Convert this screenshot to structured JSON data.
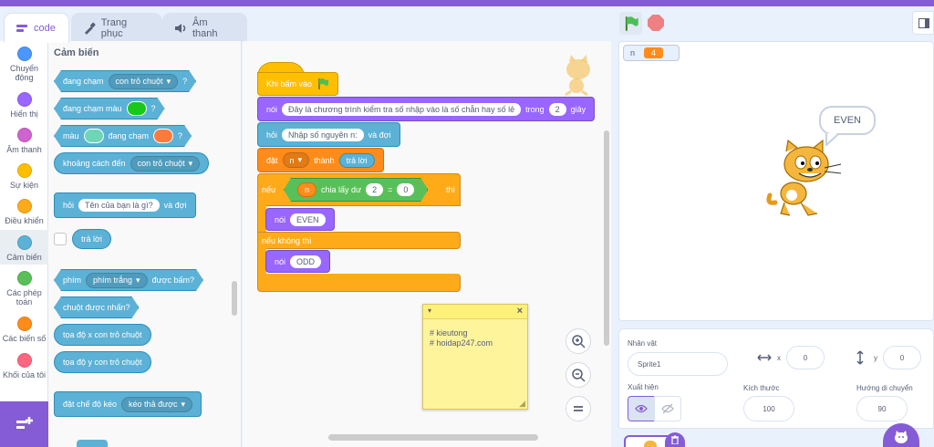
{
  "tabs": [
    {
      "label": "code"
    },
    {
      "label": "Trang phục"
    },
    {
      "label": "Âm thanh"
    }
  ],
  "categories": [
    {
      "label": "Chuyển động",
      "color": "#4c97ff"
    },
    {
      "label": "Hiển thị",
      "color": "#9966ff"
    },
    {
      "label": "Âm thanh",
      "color": "#cf63cf"
    },
    {
      "label": "Sự kiện",
      "color": "#ffbf00"
    },
    {
      "label": "Điều khiển",
      "color": "#ffab19"
    },
    {
      "label": "Cảm biến",
      "color": "#5cb1d6"
    },
    {
      "label": "Các phép toán",
      "color": "#59c059"
    },
    {
      "label": "Các biến số",
      "color": "#ff8c1a"
    },
    {
      "label": "Khối của tôi",
      "color": "#ff6680"
    }
  ],
  "palette": {
    "title": "Cảm biến",
    "touching": {
      "label": "đang chạm",
      "value": "con trỏ chuột",
      "end": "?"
    },
    "touching_color": {
      "label": "đang chạm màu",
      "end": "?"
    },
    "color_touching": {
      "label1": "màu",
      "label2": "đang chạm",
      "end": "?"
    },
    "distance": {
      "label": "khoảng cách đến",
      "value": "con trỏ chuột"
    },
    "ask": {
      "label": "hỏi",
      "value": "Tên của bạn là gì?",
      "end": "và đợi"
    },
    "answer": {
      "label": "trả lời"
    },
    "key": {
      "label": "phím",
      "value": "phím trắng",
      "end": "được bấm?"
    },
    "mouse_down": {
      "label": "chuột được nhấn?"
    },
    "mouse_x": {
      "label": "tọa độ x con trỏ chuột"
    },
    "mouse_y": {
      "label": "tọa độ y con trỏ chuột"
    },
    "drag": {
      "label": "đặt chế độ kéo",
      "value": "kéo thả được"
    }
  },
  "script": {
    "hat": "Khi bấm vào",
    "say_label": "nói",
    "say_text": "Đây là chương trình kiểm tra số nhập vào là số chẵn hay số lẻ",
    "say_in": "trong",
    "say_secs": "2",
    "say_unit": "giây",
    "ask_label": "hỏi",
    "ask_text": "Nhập số nguyên n:",
    "ask_end": "và đợi",
    "set_label": "đặt",
    "set_var": "n",
    "set_to": "thành",
    "set_value": "trả lời",
    "if_label": "nếu",
    "if_var": "n",
    "mod_label": "chia lấy dư",
    "mod_value": "2",
    "eq": "=",
    "eq_value": "0",
    "then_label": "thì",
    "say_even_label": "nói",
    "say_even": "EVEN",
    "else_label": "nếu không thì",
    "say_odd_label": "nói",
    "say_odd": "ODD"
  },
  "note": {
    "text": "# kieutong\n# hoidap247.com"
  },
  "stage": {
    "monitor_name": "n",
    "monitor_value": "4",
    "bubble": "EVEN"
  },
  "sprite": {
    "label": "Nhân vật",
    "name": "Sprite1",
    "x_label": "x",
    "x": "0",
    "y_label": "y",
    "y": "0",
    "show_label": "Xuất hiện",
    "size_label": "Kích thước",
    "size": "100",
    "dir_label": "Hướng di chuyển",
    "dir": "90"
  }
}
